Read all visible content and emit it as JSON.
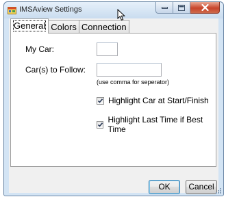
{
  "window": {
    "title": "IMSAview Settings"
  },
  "tabs": [
    {
      "label": "General",
      "active": true
    },
    {
      "label": "Colors",
      "active": false
    },
    {
      "label": "Connection",
      "active": false
    }
  ],
  "general": {
    "my_car_label": "My Car:",
    "my_car_value": "",
    "follow_label": "Car(s) to Follow:",
    "follow_value": "",
    "follow_hint": "(use comma for seperator)",
    "highlight_start_finish_label": "Highlight Car at Start/Finish",
    "highlight_start_finish_checked": true,
    "highlight_best_time_label": "Highlight Last Time if Best Time",
    "highlight_best_time_checked": true
  },
  "buttons": {
    "ok": "OK",
    "cancel": "Cancel"
  },
  "colors": {
    "titlebar": "#d3e4f4",
    "close_button": "#c8442b",
    "default_button_border": "#3c7fb1"
  }
}
